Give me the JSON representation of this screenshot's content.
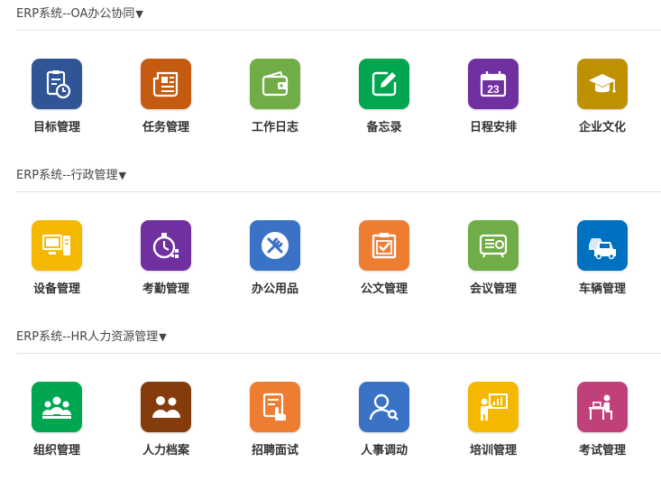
{
  "sections": [
    {
      "title": "ERP系统--OA办公协同",
      "arrow": "▼",
      "items": [
        {
          "label": "目标管理",
          "color": "#2f5597",
          "icon": "clipboard-clock-icon"
        },
        {
          "label": "任务管理",
          "color": "#c55a11",
          "icon": "newspaper-icon"
        },
        {
          "label": "工作日志",
          "color": "#70ad47",
          "icon": "wallet-icon"
        },
        {
          "label": "备忘录",
          "color": "#00a650",
          "icon": "edit-note-icon"
        },
        {
          "label": "日程安排",
          "color": "#7030a0",
          "icon": "calendar-icon"
        },
        {
          "label": "企业文化",
          "color": "#bf9000",
          "icon": "graduation-cap-icon"
        }
      ]
    },
    {
      "title": "ERP系统--行政管理",
      "arrow": "▼",
      "items": [
        {
          "label": "设备管理",
          "color": "#f5b800",
          "icon": "computer-icon"
        },
        {
          "label": "考勤管理",
          "color": "#7030a0",
          "icon": "stopwatch-icon"
        },
        {
          "label": "办公用品",
          "color": "#3a72c6",
          "icon": "tools-icon"
        },
        {
          "label": "公文管理",
          "color": "#ed7d31",
          "icon": "document-check-icon"
        },
        {
          "label": "会议管理",
          "color": "#70ad47",
          "icon": "projector-icon"
        },
        {
          "label": "车辆管理",
          "color": "#0070c0",
          "icon": "cars-icon"
        }
      ]
    },
    {
      "title": "ERP系统--HR人力资源管理",
      "arrow": "▼",
      "items": [
        {
          "label": "组织管理",
          "color": "#00a650",
          "icon": "people-group-icon"
        },
        {
          "label": "人力档案",
          "color": "#843c0c",
          "icon": "profile-people-icon"
        },
        {
          "label": "招聘面试",
          "color": "#ed7d31",
          "icon": "recruit-touch-icon"
        },
        {
          "label": "人事调动",
          "color": "#3a72c6",
          "icon": "person-search-icon"
        },
        {
          "label": "培训管理",
          "color": "#f5b800",
          "icon": "training-board-icon"
        },
        {
          "label": "考试管理",
          "color": "#c0407a",
          "icon": "exam-desk-icon"
        }
      ]
    }
  ]
}
